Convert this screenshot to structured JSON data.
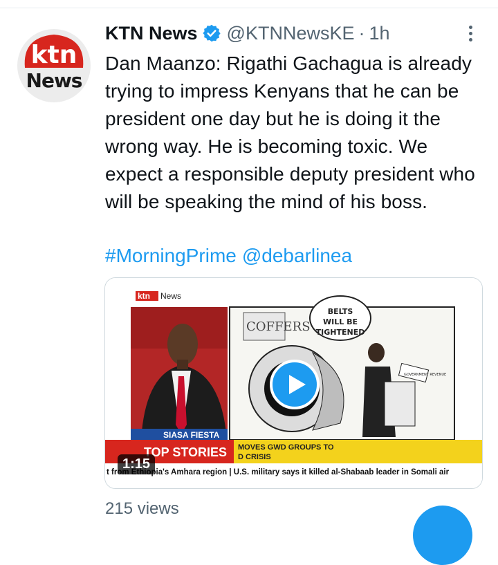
{
  "account": {
    "avatar_top": "ktn",
    "avatar_bottom": "News",
    "name": "KTN News",
    "handle": "@KTNNewsKE",
    "separator": "·",
    "time": "1h"
  },
  "tweet": {
    "text": "Dan Maanzo: Rigathi Gachagua is already trying to impress Kenyans that he can be president one day but he is doing it the wrong way. He is becoming toxic. We expect a responsible deputy president who will be speaking the mind of his boss.",
    "hashtag": "#MorningPrime",
    "mention": "@debarlinea"
  },
  "video": {
    "logo_ktn": "ktn",
    "logo_news": "News",
    "cartoon_coffers": "COFFERS",
    "cartoon_bubble": [
      "BELTS",
      "WILL BE",
      "TIGHTENED"
    ],
    "cartoon_podium": "GOVERNMENT REVENUE",
    "lower_third": "SIASA FIESTA",
    "top_stories": "TOP STORIES",
    "headline": [
      "MOVES GWD GROUPS TO",
      "D CRISIS"
    ],
    "ticker": "t from Ethiopia's Amhara region  |  U.S. military says it killed al-Shabaab leader in Somali air",
    "duration": "1:15"
  },
  "stats": {
    "views": "215 views"
  },
  "colors": {
    "accent": "#1d9bf0",
    "ktn_red": "#d7261e",
    "ticker_yellow": "#f3d21c"
  },
  "icons": {
    "verified": "verified-badge-icon",
    "more": "more-options-icon",
    "play": "play-icon",
    "fab": "compose-tweet-icon"
  }
}
